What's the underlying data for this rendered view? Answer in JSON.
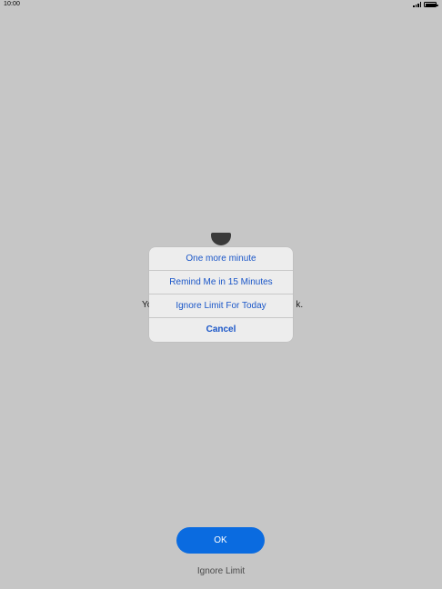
{
  "status_bar": {
    "time": "10:00",
    "signal_icon": "signal-bars-icon",
    "battery_icon": "battery-icon"
  },
  "limit_screen": {
    "icon": "hourglass-icon",
    "message_start": "Yo",
    "message_end": "k.",
    "ok_label": "OK",
    "ignore_label": "Ignore Limit"
  },
  "action_sheet": {
    "items": [
      {
        "label": "One more minute"
      },
      {
        "label": "Remind Me in 15 Minutes"
      },
      {
        "label": "Ignore Limit For Today"
      }
    ],
    "cancel_label": "Cancel"
  },
  "colors": {
    "background": "#c6c6c6",
    "sheet_background": "#ededed",
    "action_text": "#1a56c8",
    "primary_button": "#0a6be0"
  }
}
